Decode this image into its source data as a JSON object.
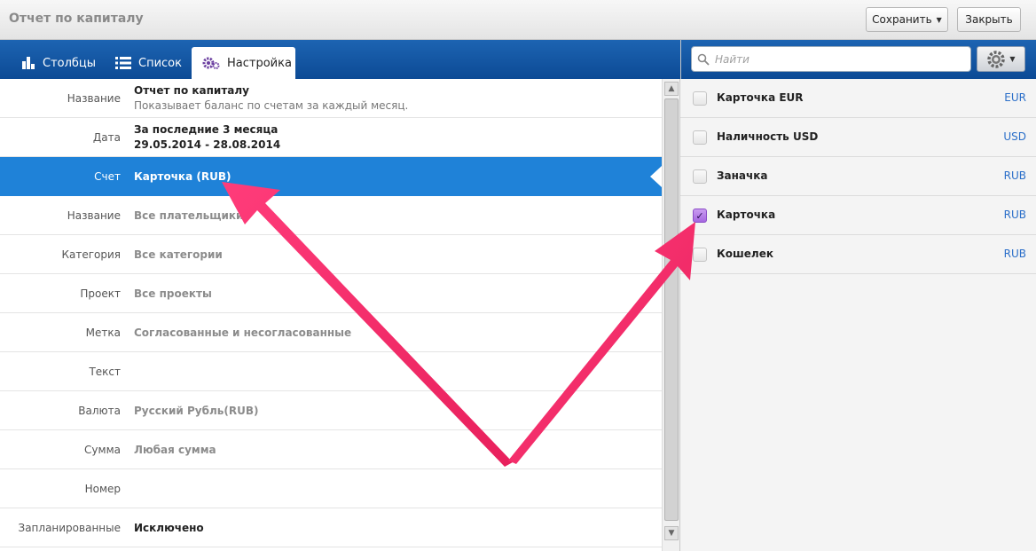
{
  "window": {
    "title": "Отчет по капиталу",
    "save_label": "Сохранить",
    "close_label": "Закрыть"
  },
  "tabs": [
    {
      "label": "Столбцы",
      "icon": "bar-chart-icon"
    },
    {
      "label": "Список",
      "icon": "list-icon"
    },
    {
      "label": "Настройка",
      "icon": "gears-icon"
    }
  ],
  "search": {
    "placeholder": "Найти"
  },
  "form": {
    "rows": [
      {
        "label": "Название",
        "value": "Отчет по капиталу",
        "sub": "Показывает баланс по счетам за каждый месяц."
      },
      {
        "label": "Дата",
        "value": "За последние 3 месяца",
        "sub": "29.05.2014 - 28.08.2014"
      },
      {
        "label": "Счет",
        "value": "Карточка (RUB)"
      },
      {
        "label": "Название",
        "value": "Все плательщики"
      },
      {
        "label": "Категория",
        "value": "Все категории"
      },
      {
        "label": "Проект",
        "value": "Все проекты"
      },
      {
        "label": "Метка",
        "value": "Согласованные и несогласованные"
      },
      {
        "label": "Текст",
        "value": ""
      },
      {
        "label": "Валюта",
        "value": "Русский Рубль(RUB)"
      },
      {
        "label": "Сумма",
        "value": "Любая сумма"
      },
      {
        "label": "Номер",
        "value": ""
      },
      {
        "label": "Запланированные",
        "value": "Исключено"
      }
    ]
  },
  "accounts": [
    {
      "name": "Карточка EUR",
      "currency": "EUR",
      "checked": false
    },
    {
      "name": "Наличность USD",
      "currency": "USD",
      "checked": false
    },
    {
      "name": "Заначка",
      "currency": "RUB",
      "checked": false
    },
    {
      "name": "Карточка",
      "currency": "RUB",
      "checked": true
    },
    {
      "name": "Кошелек",
      "currency": "RUB",
      "checked": false
    }
  ],
  "colors": {
    "accent_blue": "#1f82d8",
    "header_blue": "#0c4a95",
    "annotation_arrow": "#f0306a",
    "checkbox_checked": "#a566e0"
  }
}
